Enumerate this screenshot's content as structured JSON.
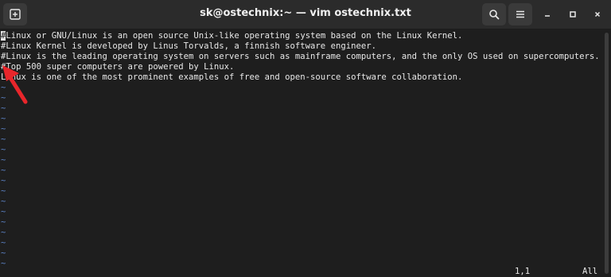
{
  "window": {
    "title": "sk@ostechnix:~ — vim ostechnix.txt"
  },
  "editor": {
    "lines": [
      {
        "cursor_char": "#",
        "text": "Linux or GNU/Linux is an open source Unix-like operating system based on the Linux Kernel."
      },
      {
        "cursor_char": "",
        "text": "#Linux Kernel is developed by Linus Torvalds, a finnish software engineer."
      },
      {
        "cursor_char": "",
        "text": "#Linux is the leading operating system on servers such as mainframe computers, and the only OS used on supercomputers."
      },
      {
        "cursor_char": "",
        "text": "#Top 500 super computers are powered by Linux."
      },
      {
        "cursor_char": "",
        "text": "Linux is one of the most prominent examples of free and open-source software collaboration."
      }
    ],
    "tilde": "~",
    "status_position": "1,1",
    "status_scroll": "All"
  },
  "colors": {
    "background": "#1e1e1e",
    "text": "#e8e8e8",
    "tilde": "#5a7fc0",
    "annotation_arrow": "#e8262b"
  },
  "icons": {
    "new_tab": "new-tab-icon",
    "search": "search-icon",
    "menu": "hamburger-menu-icon",
    "minimize": "minimize-icon",
    "maximize": "maximize-icon",
    "close": "close-icon",
    "annotation": "red-arrow-annotation-icon"
  }
}
